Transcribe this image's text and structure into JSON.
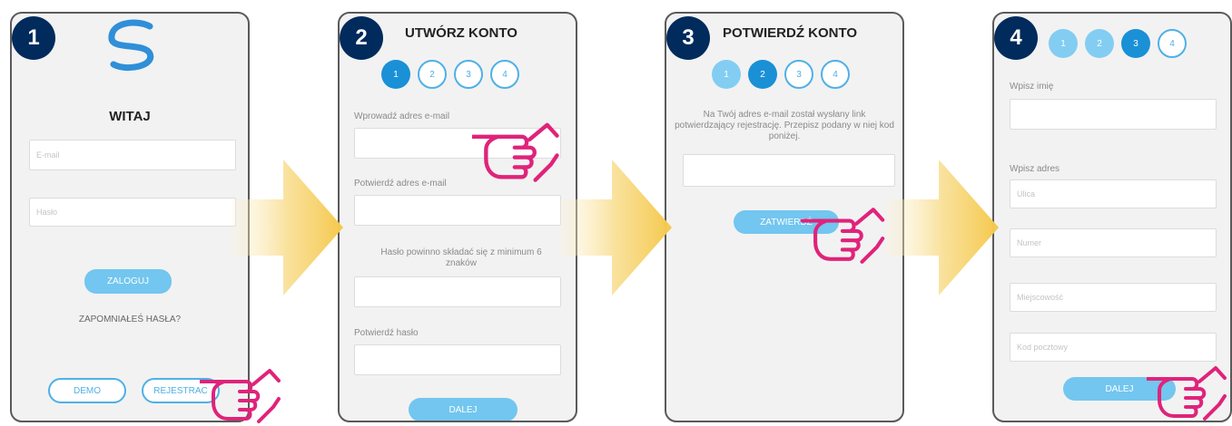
{
  "colors": {
    "accent": "#4fb0e6",
    "badge": "#002b5c",
    "hand": "#e0237a",
    "arrow": "#f5cb4c"
  },
  "panel1": {
    "badge": "1",
    "title": "WITAJ",
    "email_placeholder": "E-mail",
    "password_placeholder": "Hasło",
    "login_button": "ZALOGUJ",
    "forgot_link": "ZAPOMNIAŁEŚ HASŁA?",
    "demo_button": "DEMO",
    "register_button": "REJESTRAC"
  },
  "panel2": {
    "badge": "2",
    "title": "UTWÓRZ KONTO",
    "steps": [
      "1",
      "2",
      "3",
      "4"
    ],
    "email_label": "Wprowadź adres e-mail",
    "confirm_email_label": "Potwierdź adres e-mail",
    "password_hint": "Hasło powinno składać się z minimum 6 znaków",
    "confirm_password_label": "Potwierdź hasło",
    "next_button": "DALEJ"
  },
  "panel3": {
    "badge": "3",
    "title": "POTWIERDŹ KONTO",
    "steps": [
      "1",
      "2",
      "3",
      "4"
    ],
    "message": "Na Twój adres e-mail został wysłany link potwierdzający rejestrację. Przepisz podany w niej kod poniżej.",
    "confirm_button": "ZATWIERDŹ"
  },
  "panel4": {
    "badge": "4",
    "steps": [
      "1",
      "2",
      "3",
      "4"
    ],
    "name_label": "Wpisz imię",
    "address_label": "Wpisz adres",
    "address_fields": [
      "Ulica",
      "Numer",
      "Miejscowość",
      "Kod pocztowy"
    ],
    "next_button": "DALEJ"
  }
}
